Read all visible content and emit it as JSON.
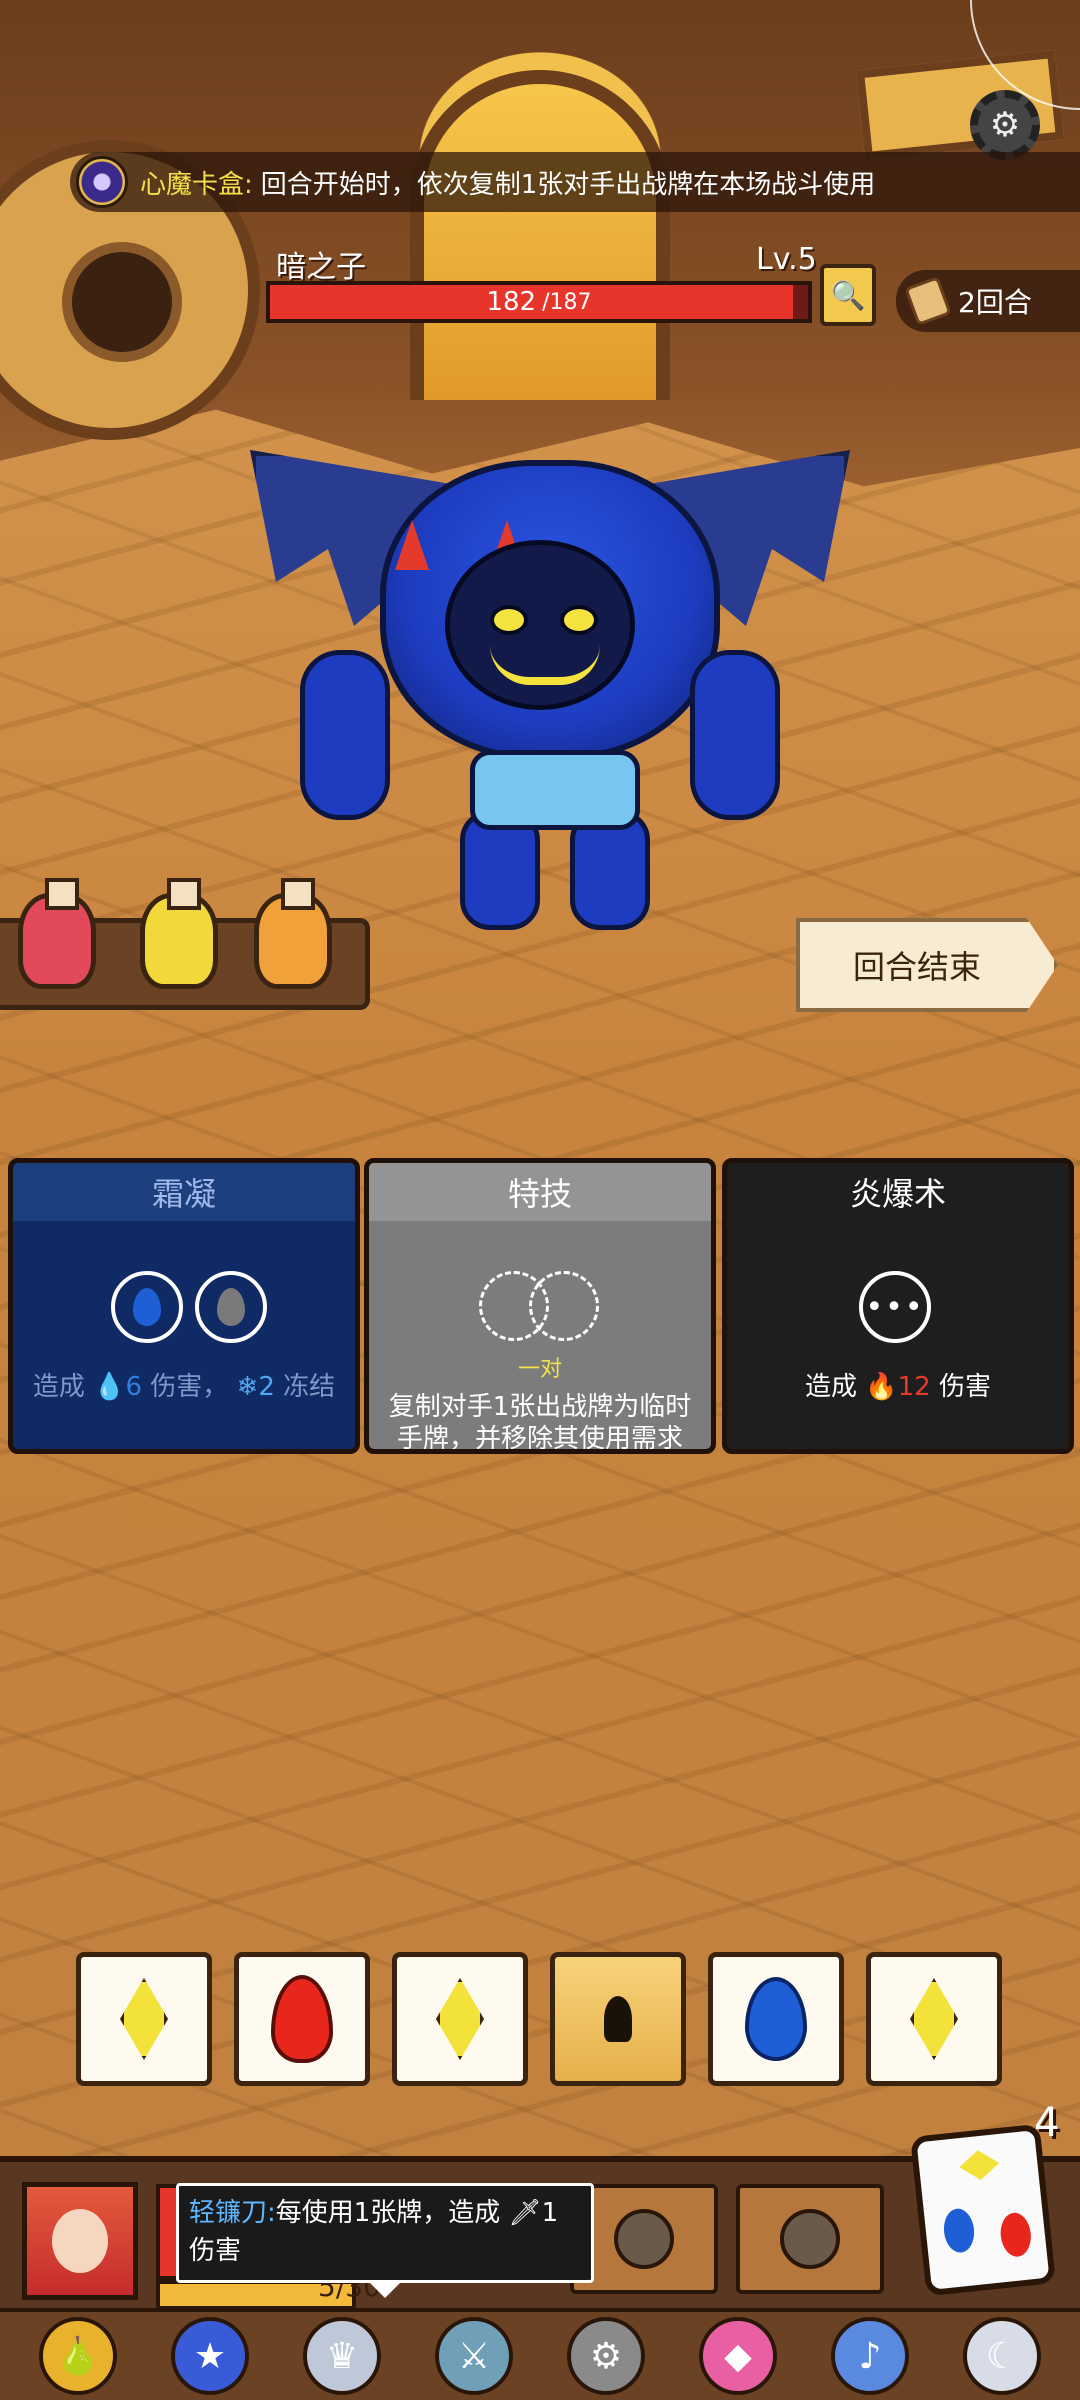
{
  "buff": {
    "icon": "demon-card-box-icon",
    "name": "心魔卡盒:",
    "description": "回合开始时，依次复制1张对手出战牌在本场战斗使用"
  },
  "enemy": {
    "name": "暗之子",
    "level": "Lv.5",
    "hp_current": "182",
    "hp_max": "/187",
    "hp_fraction": 0.973
  },
  "turn": {
    "label": "2回合"
  },
  "potions": [
    {
      "name": "red-potion",
      "color": "#e24a5c"
    },
    {
      "name": "yellow-potion",
      "color": "#f2d83a"
    },
    {
      "name": "orange-potion",
      "color": "#f0a13a"
    }
  ],
  "end_turn": {
    "label": "回合结束"
  },
  "cards": {
    "frost": {
      "title": "霜凝",
      "desc_prefix": "造成",
      "damage": "6",
      "desc_middle": "伤害，",
      "freeze": "2",
      "desc_suffix": "冻结"
    },
    "skill": {
      "title": "特技",
      "slot_label": "一对",
      "description": "复制对手1张出战牌为临时手牌，并移除其使用需求"
    },
    "fire": {
      "title": "炎爆术",
      "desc_prefix": "造成",
      "damage": "12",
      "desc_suffix": "伤害"
    }
  },
  "dice": [
    {
      "face": "yellow-diamond"
    },
    {
      "face": "red-fire"
    },
    {
      "face": "yellow-diamond"
    },
    {
      "face": "locked"
    },
    {
      "face": "blue-water"
    },
    {
      "face": "yellow-diamond"
    }
  ],
  "dice_remaining": "4",
  "player": {
    "deck_count": "5/30",
    "hp_fraction": 0.6
  },
  "tooltip": {
    "name": "轻镰刀:",
    "line1": "每使用1张牌，造成",
    "value": "1",
    "line2": "伤害"
  },
  "relics": [
    "golden-fruit-icon",
    "crystal-ball-icon",
    "silver-crown-icon",
    "sickle-icon",
    "shield-wheel-icon",
    "pink-d20-icon",
    "horn-icon",
    "moon-ring-icon"
  ],
  "colors": {
    "hp_red": "#e8352b",
    "gold_text": "#f5e14a",
    "water_blue": "#1f5fd6",
    "fire_red": "#e8261c"
  }
}
